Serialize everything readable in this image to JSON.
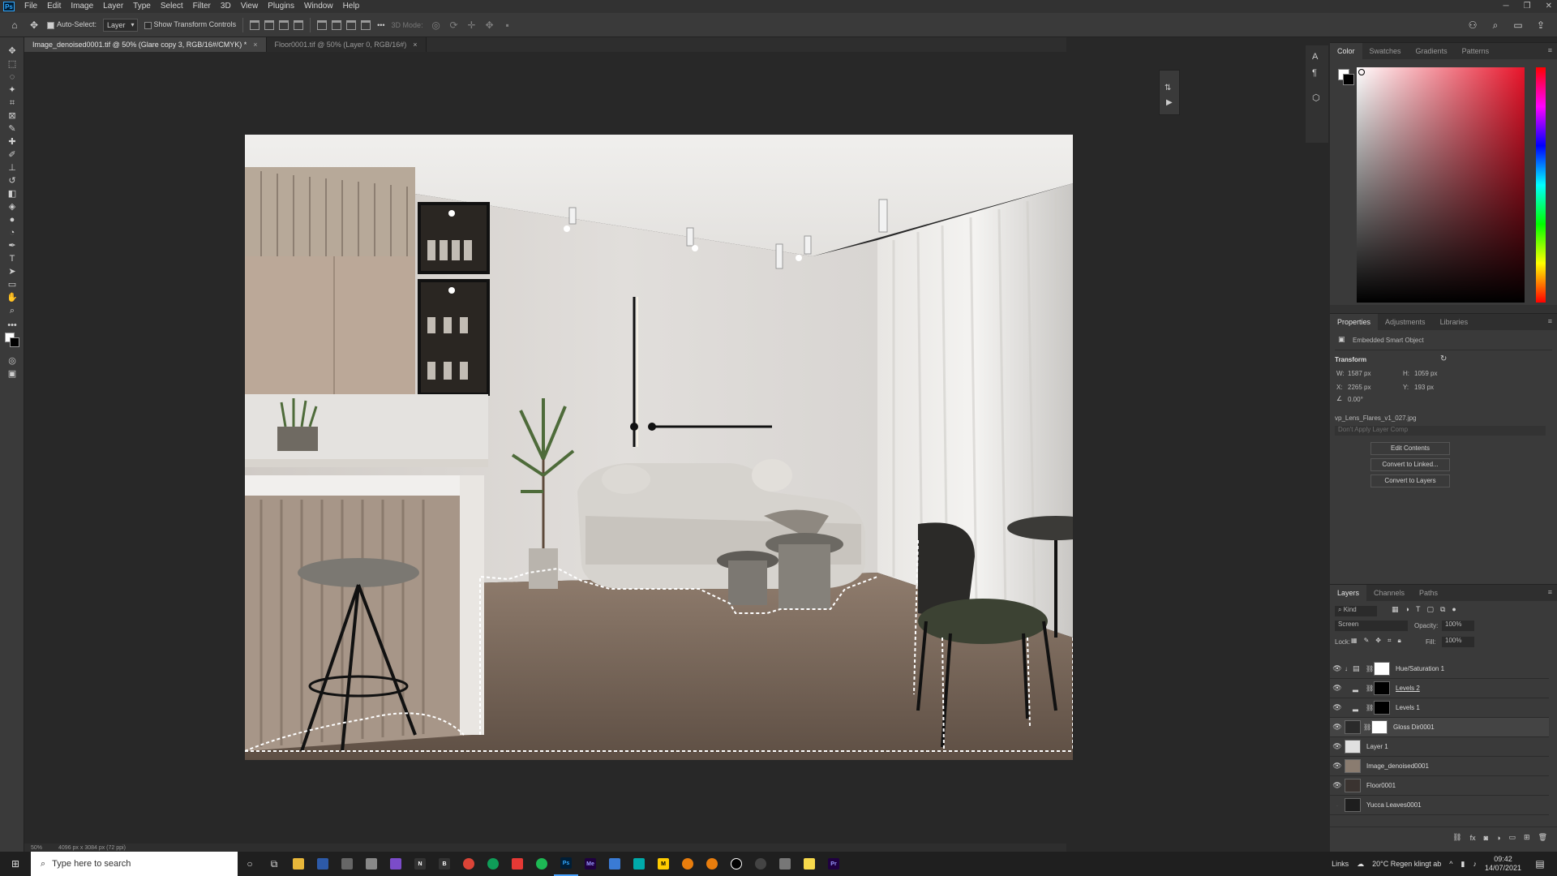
{
  "menu": {
    "items": [
      "File",
      "Edit",
      "Image",
      "Layer",
      "Type",
      "Select",
      "Filter",
      "3D",
      "View",
      "Plugins",
      "Window",
      "Help"
    ]
  },
  "options": {
    "auto_select_label": "Auto-Select:",
    "auto_select_value": "Layer",
    "transform_label": "Show Transform Controls",
    "more": "•••",
    "mode_3d": "3D Mode:"
  },
  "tabs": [
    {
      "label": "Image_denoised0001.tif @ 50% (Glare copy 3, RGB/16#/CMYK) *",
      "close": "×"
    },
    {
      "label": "Floor0001.tif @ 50% (Layer 0, RGB/16#)",
      "close": "×"
    }
  ],
  "status": {
    "zoom": "50%",
    "dims": "4096 px x 3084 px (72 ppi)"
  },
  "color_panel": {
    "tabs": [
      "Color",
      "Swatches",
      "Gradients",
      "Patterns"
    ]
  },
  "properties": {
    "tabs": [
      "Properties",
      "Adjustments",
      "Libraries"
    ],
    "kind": "Embedded Smart Object",
    "section": "Transform",
    "w_label": "W:",
    "w_value": "1587 px",
    "h_label": "H:",
    "h_value": "1059 px",
    "x_label": "X:",
    "x_value": "2265 px",
    "y_label": "Y:",
    "y_value": "193 px",
    "angle_value": "0.00°",
    "file": "vp_Lens_Flares_v1_027.jpg",
    "comp": "Don't Apply Layer Comp",
    "buttons": [
      "Edit Contents",
      "Convert to Linked...",
      "Convert to Layers"
    ]
  },
  "layers": {
    "tabs": [
      "Layers",
      "Channels",
      "Paths"
    ],
    "filter": "Kind",
    "blend": "Screen",
    "opacity_label": "Opacity:",
    "opacity_value": "100%",
    "lock_label": "Lock:",
    "fill_label": "Fill:",
    "fill_value": "100%",
    "items": [
      {
        "name": "Hue/Saturation 1"
      },
      {
        "name": "Levels 2"
      },
      {
        "name": "Levels 1"
      },
      {
        "name": "Gloss Dir0001"
      },
      {
        "name": "Layer 1"
      },
      {
        "name": "Image_denoised0001"
      },
      {
        "name": "Floor0001"
      },
      {
        "name": "Yucca Leaves0001"
      }
    ]
  },
  "taskbar": {
    "search_placeholder": "Type here to search",
    "apps": [
      "Ps",
      "Me",
      "M",
      "Pr"
    ],
    "links": "Links",
    "weather": "20°C  Regen klingt ab",
    "time": "09:42",
    "date": "14/07/2021"
  }
}
